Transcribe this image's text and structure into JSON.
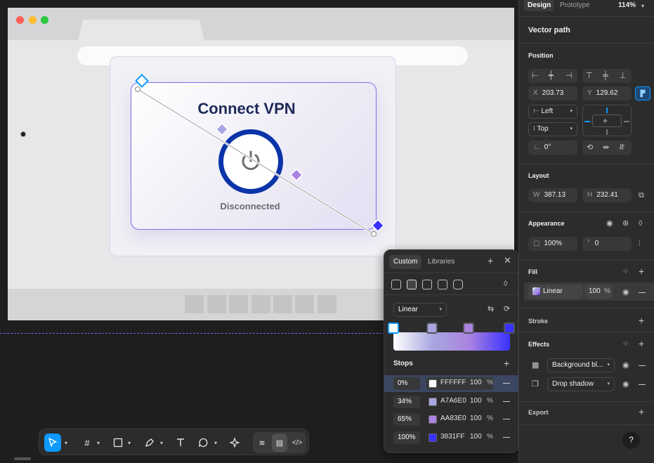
{
  "panel": {
    "tabs": {
      "design": "Design",
      "prototype": "Prototype"
    },
    "zoom": "114%",
    "layer_title": "Vector path",
    "position": {
      "title": "Position",
      "x_label": "X",
      "x_value": "203.73",
      "y_label": "Y",
      "y_value": "129.62",
      "h_constraint": "Left",
      "v_constraint": "Top",
      "rotation": "0°"
    },
    "layout": {
      "title": "Layout",
      "w_label": "W",
      "w_value": "387.13",
      "h_label": "H",
      "h_value": "232.41"
    },
    "appearance": {
      "title": "Appearance",
      "opacity": "100%",
      "radius": "0"
    },
    "fill": {
      "title": "Fill",
      "type": "Linear",
      "opacity": "100",
      "percent": "%"
    },
    "stroke": {
      "title": "Stroke"
    },
    "effects": {
      "title": "Effects",
      "items": [
        "Background bl...",
        "Drop shadow"
      ]
    },
    "export": {
      "title": "Export"
    },
    "help": "?"
  },
  "canvas": {
    "vpn_title": "Connect VPN",
    "status": "Disconnected"
  },
  "popup": {
    "tabs": {
      "custom": "Custom",
      "libraries": "Libraries"
    },
    "gradient_type": "Linear",
    "stops_title": "Stops",
    "percent_sign": "%",
    "stops": [
      {
        "position": "0%",
        "hex": "FFFFFF",
        "opacity": "100",
        "color": "#FFFFFF"
      },
      {
        "position": "34%",
        "hex": "A7A6E0",
        "opacity": "100",
        "color": "#A7A6E0"
      },
      {
        "position": "65%",
        "hex": "AA83E0",
        "opacity": "100",
        "color": "#AA83E0"
      },
      {
        "position": "100%",
        "hex": "3831FF",
        "opacity": "100",
        "color": "#3831FF"
      }
    ]
  },
  "colors": {
    "accent": "#0d99ff",
    "vpn_ring": "#0c34a9",
    "selection": "#7d5ee8"
  }
}
